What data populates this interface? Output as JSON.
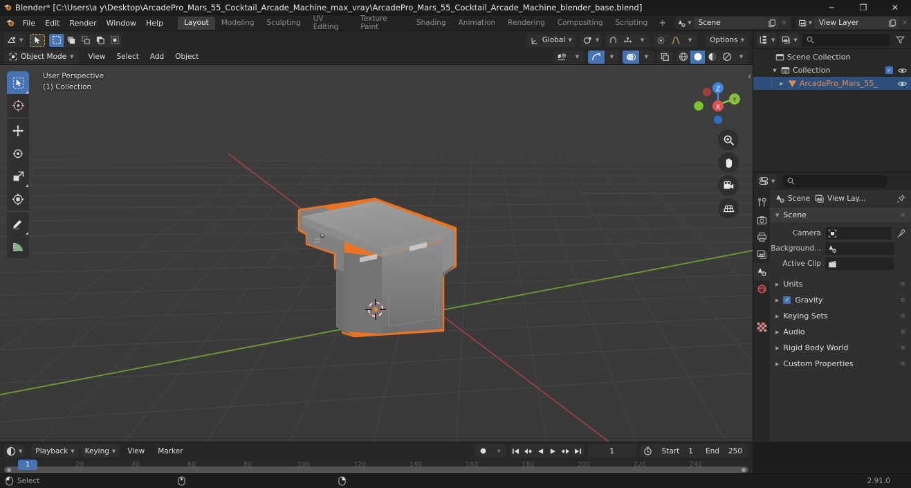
{
  "window": {
    "title": "Blender* [C:\\Users\\a y\\Desktop\\ArcadePro_Mars_55_Cocktail_Arcade_Machine_max_vray\\ArcadePro_Mars_55_Cocktail_Arcade_Machine_blender_base.blend]",
    "minimize": "─",
    "maximize": "❐",
    "close": "✕"
  },
  "topbar": {
    "menus": [
      "File",
      "Edit",
      "Render",
      "Window",
      "Help"
    ],
    "workspaces": [
      {
        "label": "Layout",
        "active": true
      },
      {
        "label": "Modeling",
        "active": false
      },
      {
        "label": "Sculpting",
        "active": false
      },
      {
        "label": "UV Editing",
        "active": false
      },
      {
        "label": "Texture Paint",
        "active": false
      },
      {
        "label": "Shading",
        "active": false
      },
      {
        "label": "Animation",
        "active": false
      },
      {
        "label": "Rendering",
        "active": false
      },
      {
        "label": "Compositing",
        "active": false
      },
      {
        "label": "Scripting",
        "active": false
      }
    ],
    "add_workspace": "+",
    "scene_name": "Scene",
    "view_layer_name": "View Layer",
    "new_scene_icon": "copy-icon",
    "remove_scene_icon": "x-icon"
  },
  "viewport": {
    "editor_type_icon": "editor-type-icon",
    "mode": "Object Mode",
    "menus": [
      "View",
      "Select",
      "Add",
      "Object"
    ],
    "transform_orientation": "Global",
    "options_label": "Options",
    "overlay_text": {
      "perspective": "User Perspective",
      "collection": "(1) Collection"
    },
    "select_modes": [
      "select-box",
      "select-extend",
      "select-subtract",
      "select-invert",
      "select-intersect"
    ],
    "snap_icons": [
      "magnet-icon",
      "snap-increment-icon"
    ],
    "proportional_icons": [
      "proportional-edit-icon",
      "falloff-curve-icon"
    ],
    "gizmo_toggles": [
      "show-gizmo-icon",
      "show-overlays-icon",
      "xray-toggle-icon"
    ],
    "shading_modes": [
      "wireframe",
      "solid",
      "material-preview",
      "rendered"
    ],
    "shading_active": "solid",
    "tools": [
      {
        "name": "tweak-tool",
        "active": true
      },
      {
        "name": "cursor-tool",
        "active": false
      },
      {
        "name": "move-tool",
        "active": false
      },
      {
        "name": "rotate-tool",
        "active": false
      },
      {
        "name": "scale-tool",
        "active": false
      },
      {
        "name": "transform-tool",
        "active": false
      },
      {
        "name": "annotate-tool",
        "active": false
      },
      {
        "name": "measure-tool",
        "active": false
      }
    ],
    "gizmo_axes": [
      {
        "label": "X",
        "color": "#e0504f"
      },
      {
        "label": "Y",
        "color": "#8cbe3f"
      },
      {
        "label": "Z",
        "color": "#3f86e0"
      }
    ],
    "nav_buttons": [
      "zoom-icon",
      "pan-icon",
      "camera-view-icon",
      "toggle-ortho-icon"
    ],
    "colors": {
      "background": "#3b3b3b",
      "grid": "#4a4a4a",
      "axis_x": "#a33d44",
      "axis_y": "#6a9e2f",
      "object_fill": "#8a8a8a",
      "selection_outline": "#ed7322"
    }
  },
  "outliner": {
    "display_mode_icon": "outliner-view-layer-icon",
    "filter_icon": "filter-icon",
    "search_placeholder": "",
    "rows": [
      {
        "label": "Scene Collection",
        "icon": "scene-collection-icon",
        "indent": 0,
        "expandable": false,
        "selected": false,
        "checkbox": false,
        "eye": false
      },
      {
        "label": "Collection",
        "icon": "collection-icon",
        "indent": 1,
        "expandable": true,
        "expanded": true,
        "selected": false,
        "checkbox": true,
        "eye": true
      },
      {
        "label": "ArcadePro_Mars_55_",
        "icon": "mesh-object-icon",
        "indent": 2,
        "expandable": true,
        "expanded": false,
        "selected": true,
        "checkbox": false,
        "eye": true
      }
    ]
  },
  "properties": {
    "editor_icon": "properties-editor-icon",
    "search_placeholder": "",
    "tabs": [
      {
        "name": "tool-tab",
        "icon": "tool-icon",
        "active": false
      },
      {
        "name": "render-tab",
        "icon": "camera-back-icon",
        "active": false
      },
      {
        "name": "output-tab",
        "icon": "printer-icon",
        "active": false
      },
      {
        "name": "view-layer-tab",
        "icon": "images-icon",
        "active": false
      },
      {
        "name": "scene-tab",
        "icon": "scene-icon",
        "active": true
      },
      {
        "name": "world-tab",
        "icon": "world-icon",
        "active": false
      },
      {
        "name": "texture-tab",
        "icon": "checker-icon",
        "active": false
      }
    ],
    "breadcrumb": [
      {
        "label": "Scene",
        "icon": "scene-icon"
      },
      {
        "label": "View Lay...",
        "icon": "view-layer-icon"
      }
    ],
    "pin_icon": "pin-icon",
    "panel_title": "Scene",
    "fields": [
      {
        "label": "Camera",
        "value": "",
        "icon": "camera-data-icon",
        "has_eyedropper": true
      },
      {
        "label": "Background...",
        "value": "",
        "icon": "scene-icon",
        "has_eyedropper": false
      },
      {
        "label": "Active Clip",
        "value": "",
        "icon": "clip-icon",
        "has_eyedropper": false
      }
    ],
    "sections": [
      {
        "label": "Units",
        "checkbox": false,
        "expanded": false
      },
      {
        "label": "Gravity",
        "checkbox": true,
        "checked": true,
        "expanded": false
      },
      {
        "label": "Keying Sets",
        "checkbox": false,
        "expanded": false
      },
      {
        "label": "Audio",
        "checkbox": false,
        "expanded": false
      },
      {
        "label": "Rigid Body World",
        "checkbox": false,
        "expanded": false
      },
      {
        "label": "Custom Properties",
        "checkbox": false,
        "expanded": false
      }
    ]
  },
  "timeline": {
    "editor_icon": "timeline-editor-icon",
    "menus": [
      "Playback",
      "Keying",
      "View",
      "Marker"
    ],
    "auto_key_icon": "record-icon",
    "playback_controls": [
      "jump-start",
      "prev-keyframe",
      "play-reverse",
      "play",
      "next-keyframe",
      "jump-end"
    ],
    "current_frame": "1",
    "frame_icon": "use-preview-range-icon",
    "start_label": "Start",
    "start_value": "1",
    "end_label": "End",
    "end_value": "250",
    "ticks": [
      {
        "label": "20",
        "frame": 20
      },
      {
        "label": "40",
        "frame": 40
      },
      {
        "label": "60",
        "frame": 60
      },
      {
        "label": "80",
        "frame": 80
      },
      {
        "label": "100",
        "frame": 100
      },
      {
        "label": "120",
        "frame": 120
      },
      {
        "label": "140",
        "frame": 140
      },
      {
        "label": "160",
        "frame": 160
      },
      {
        "label": "180",
        "frame": 180
      },
      {
        "label": "200",
        "frame": 200
      },
      {
        "label": "220",
        "frame": 220
      },
      {
        "label": "240",
        "frame": 240
      }
    ],
    "playhead_label": "1"
  },
  "statusbar": {
    "mouse_hints": [
      {
        "icon": "mouse-left-icon",
        "label": "Select"
      },
      {
        "icon": "mouse-middle-icon",
        "label": ""
      },
      {
        "icon": "mouse-right-icon",
        "label": ""
      }
    ],
    "version": "2.91.0"
  }
}
